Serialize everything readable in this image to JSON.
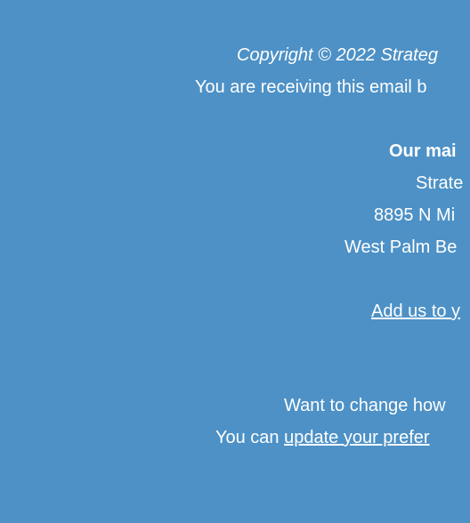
{
  "footer": {
    "copyright": "Copyright © 2022 Strateg",
    "receiving": "You are receiving this email b",
    "mailing_heading": "Our mai",
    "address": {
      "name": "Strate",
      "street": "8895 N Mi",
      "city": "West Palm Be"
    },
    "add_to_address_book": "Add us to y",
    "change_prompt": "Want to change how",
    "you_can": "You can ",
    "update_preferences": "update your prefer"
  },
  "colors": {
    "background": "#4d91c6",
    "text": "#ffffff"
  }
}
